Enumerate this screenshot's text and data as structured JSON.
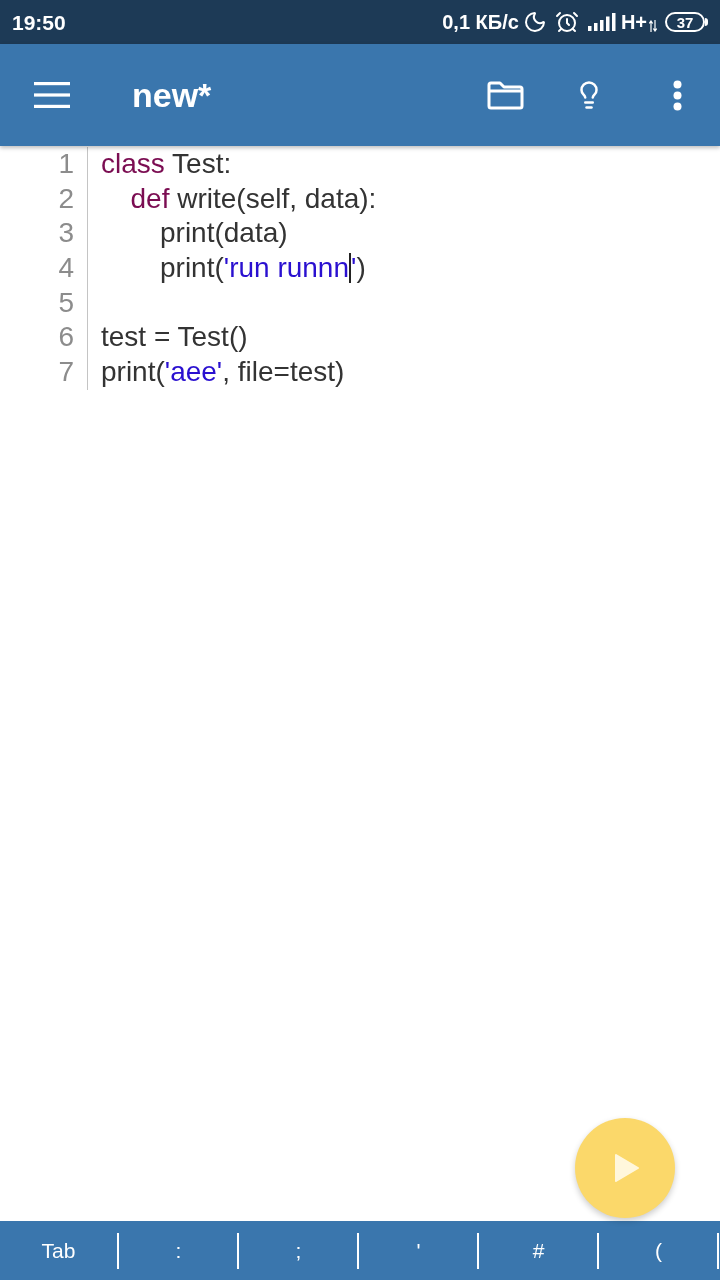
{
  "status_bar": {
    "time": "19:50",
    "net_speed": "0,1 КБ/с",
    "network_type": "H+",
    "battery": "37"
  },
  "toolbar": {
    "title": "new*"
  },
  "editor": {
    "lines": [
      {
        "number": "1",
        "tokens": [
          {
            "kind": "keyword",
            "text": "class"
          },
          {
            "kind": "plain",
            "text": " Test:"
          }
        ],
        "children": [
          {
            "number": "2",
            "tokens": [
              {
                "kind": "keyword",
                "text": "def"
              },
              {
                "kind": "plain",
                "text": " write(self, data):"
              }
            ],
            "children": [
              {
                "number": "3",
                "tokens": [
                  {
                    "kind": "plain",
                    "text": "print(data)"
                  }
                ]
              },
              {
                "number": "4",
                "tokens": [
                  {
                    "kind": "plain",
                    "text": "print("
                  },
                  {
                    "kind": "string",
                    "text": "'run runnn"
                  },
                  {
                    "kind": "caret"
                  },
                  {
                    "kind": "string",
                    "text": "'"
                  },
                  {
                    "kind": "plain",
                    "text": ")"
                  }
                ]
              }
            ]
          }
        ]
      },
      {
        "number": "5"
      },
      {
        "number": "6",
        "tokens": [
          {
            "kind": "plain",
            "text": "test = Test()"
          }
        ]
      },
      {
        "number": "7",
        "tokens": [
          {
            "kind": "plain",
            "text": "print("
          },
          {
            "kind": "string",
            "text": "'aee'"
          },
          {
            "kind": "plain",
            "text": ", file=test)"
          }
        ]
      }
    ]
  },
  "key_bar": {
    "keys": [
      "Tab",
      ":",
      ";",
      "'",
      "#",
      "("
    ]
  }
}
